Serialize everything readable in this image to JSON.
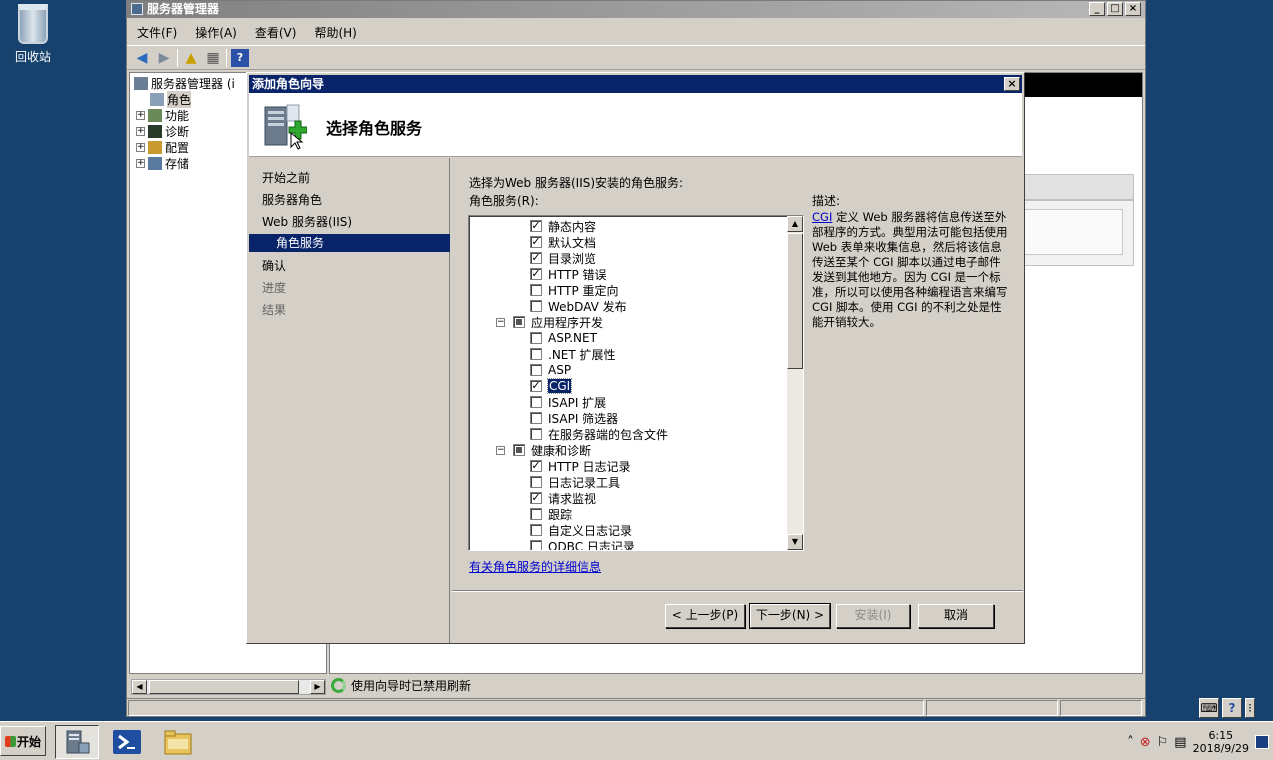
{
  "desktop": {
    "recycle_bin_label": "回收站"
  },
  "server_manager": {
    "title": "服务器管理器",
    "menu": [
      "文件(F)",
      "操作(A)",
      "查看(V)",
      "帮助(H)"
    ],
    "tree": {
      "root": "服务器管理器 (i",
      "items": [
        "角色",
        "功能",
        "诊断",
        "配置",
        "存储"
      ]
    },
    "refresh_status": "使用向导时已禁用刷新"
  },
  "dialog": {
    "title": "添加角色向导",
    "close_label": "×",
    "header_title": "选择角色服务",
    "nav": [
      {
        "label": "开始之前",
        "state": "normal"
      },
      {
        "label": "服务器角色",
        "state": "normal"
      },
      {
        "label": "Web 服务器(IIS)",
        "state": "normal"
      },
      {
        "label": "角色服务",
        "state": "active"
      },
      {
        "label": "确认",
        "state": "normal"
      },
      {
        "label": "进度",
        "state": "grey"
      },
      {
        "label": "结果",
        "state": "grey"
      }
    ],
    "prompt": "选择为Web 服务器(IIS)安装的角色服务:",
    "list_label": "角色服务(R):",
    "role_services": [
      {
        "label": "静态内容",
        "checked": true,
        "level": 2
      },
      {
        "label": "默认文档",
        "checked": true,
        "level": 2
      },
      {
        "label": "目录浏览",
        "checked": true,
        "level": 2
      },
      {
        "label": "HTTP 错误",
        "checked": true,
        "level": 2
      },
      {
        "label": "HTTP 重定向",
        "checked": false,
        "level": 2
      },
      {
        "label": "WebDAV 发布",
        "checked": false,
        "level": 2
      },
      {
        "label": "应用程序开发",
        "checked": "partial",
        "level": 1,
        "expander": "⊟"
      },
      {
        "label": "ASP.NET",
        "checked": false,
        "level": 2
      },
      {
        "label": ".NET 扩展性",
        "checked": false,
        "level": 2
      },
      {
        "label": "ASP",
        "checked": false,
        "level": 2
      },
      {
        "label": "CGI",
        "checked": true,
        "level": 2,
        "selected": true
      },
      {
        "label": "ISAPI 扩展",
        "checked": false,
        "level": 2
      },
      {
        "label": "ISAPI 筛选器",
        "checked": false,
        "level": 2
      },
      {
        "label": "在服务器端的包含文件",
        "checked": false,
        "level": 2
      },
      {
        "label": "健康和诊断",
        "checked": "partial",
        "level": 1,
        "expander": "⊟"
      },
      {
        "label": "HTTP 日志记录",
        "checked": true,
        "level": 2
      },
      {
        "label": "日志记录工具",
        "checked": false,
        "level": 2
      },
      {
        "label": "请求监视",
        "checked": true,
        "level": 2
      },
      {
        "label": "跟踪",
        "checked": false,
        "level": 2
      },
      {
        "label": "自定义日志记录",
        "checked": false,
        "level": 2
      },
      {
        "label": "ODBC 日志记录",
        "checked": false,
        "level": 2
      }
    ],
    "more_info_link": "有关角色服务的详细信息",
    "description_label": "描述:",
    "description_link": "CGI",
    "description_text": " 定义 Web 服务器将信息传送至外部程序的方式。典型用法可能包括使用 Web 表单来收集信息，然后将该信息传送至某个 CGI 脚本以通过电子邮件发送到其他地方。因为 CGI 是一个标准，所以可以使用各种编程语言来编写 CGI 脚本。使用 CGI 的不利之处是性能开销较大。",
    "buttons": {
      "prev": "< 上一步(P)",
      "next": "下一步(N) >",
      "install": "安装(I)",
      "cancel": "取消"
    }
  },
  "taskbar": {
    "start_label": "开始",
    "clock_time": "6:15",
    "clock_date": "2018/9/29"
  },
  "colors": {
    "desktop": "#17426e",
    "selection": "#0a246a",
    "link": "#0000cc"
  }
}
